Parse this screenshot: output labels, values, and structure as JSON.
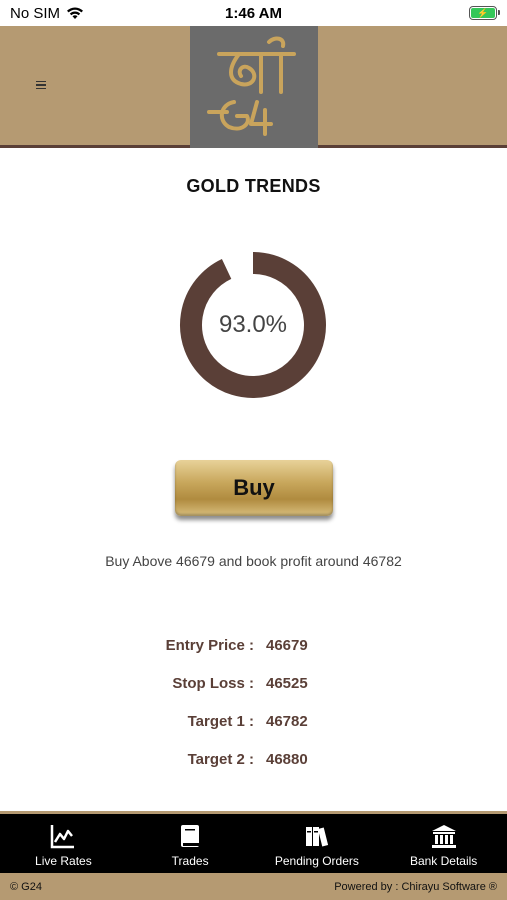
{
  "status_bar": {
    "carrier": "No SIM",
    "time": "1:46 AM",
    "icons": [
      "wifi-icon",
      "battery-charging-icon"
    ]
  },
  "header": {
    "menu_icon": "hamburger-menu-icon",
    "logo": "g24-shree-logo"
  },
  "page": {
    "title": "GOLD TRENDS"
  },
  "gauge": {
    "label": "93.0%",
    "fraction": 0.93,
    "color": "#5a3f37"
  },
  "action": {
    "label": "Buy"
  },
  "advice": "Buy Above 46679 and book profit around 46782",
  "details": [
    {
      "label": "Entry Price :",
      "value": "46679"
    },
    {
      "label": "Stop Loss :",
      "value": "46525"
    },
    {
      "label": "Target 1 :",
      "value": "46782"
    },
    {
      "label": "Target 2 :",
      "value": "46880"
    }
  ],
  "tabs": [
    {
      "label": "Live Rates",
      "icon": "line-chart-icon"
    },
    {
      "label": "Trades",
      "icon": "book-icon"
    },
    {
      "label": "Pending Orders",
      "icon": "books-icon"
    },
    {
      "label": "Bank Details",
      "icon": "bank-icon"
    }
  ],
  "footer": {
    "copyright": "© G24",
    "powered_by": "Powered by : Chirayu Software ®"
  },
  "colors": {
    "brand_tan": "#b59a72",
    "brand_brown": "#5a3f37",
    "tabbar_bg": "#000000"
  }
}
